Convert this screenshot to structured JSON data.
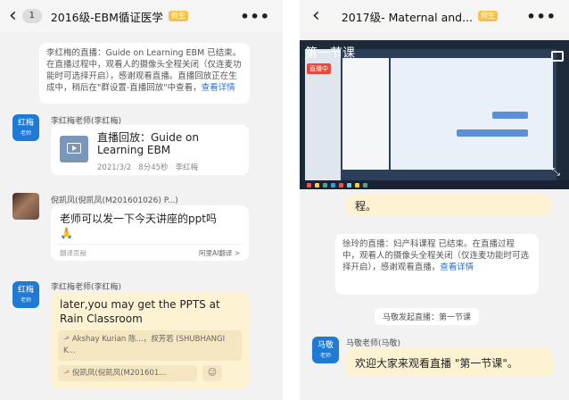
{
  "left": {
    "header": {
      "badge": "1",
      "title": "2016级-EBM循证医学",
      "tag": "师生"
    },
    "notice": {
      "text": "李红梅的直播：Guide on Learning EBM 已结束。在直播过程中，观看人的摄像头全程关闭（仅连麦功能时可选择开启），感谢观看直播。直播回放正在生成中，稍后在\"群设置-直播回放\"中查看，",
      "link": "查看详情"
    },
    "msg1": {
      "avatar_name": "红梅",
      "avatar_role": "老师",
      "sender": "李红梅老师(李红梅)",
      "card_title": "直播回放：Guide on Learning  EBM",
      "card_meta": "2021/3/2   8分45秒   李红梅"
    },
    "msg2": {
      "sender": "倪凯凤(倪凯凤(M201601026) P...)",
      "text": "老师可以发一下今天讲座的ppt吗",
      "emoji": "🙏",
      "footer_left": "翻译贡献",
      "footer_right": "阿里AI翻译 >"
    },
    "msg3": {
      "avatar_name": "红梅",
      "avatar_role": "老师",
      "sender": "李红梅老师(李红梅)",
      "text": "later,you may get the PPTS at Rain Classroom",
      "reply1": "Akshay Kurian 陈...，叔芳若 (SHUBHANGI K...",
      "reply2": "倪凯凤(倪凯凤(M201601..."
    }
  },
  "right": {
    "header": {
      "title": "2017级- Maternal and...",
      "tag": "师生"
    },
    "video": {
      "lesson": "第一节课",
      "live": "直播中"
    },
    "partial_bubble": "程。",
    "notice": {
      "text": "徐玲的直播：妇产科课程 已结束。在直播过程中，观看人的摄像头全程关闭（仅连麦功能时可选择开启），感谢观看直播，",
      "link": "查看详情"
    },
    "system": "马敬发起直播：第一节课",
    "msg": {
      "avatar_name": "马敬",
      "avatar_role": "老师",
      "sender": "马敬老师(马敬)",
      "text": "欢迎大家来观看直播 \"第一节课\"。"
    }
  },
  "colors": {
    "accent": "#1f7ad6",
    "link": "#2a6fd6",
    "tag": "#f5c24a",
    "highlight": "#fdf3d3"
  }
}
